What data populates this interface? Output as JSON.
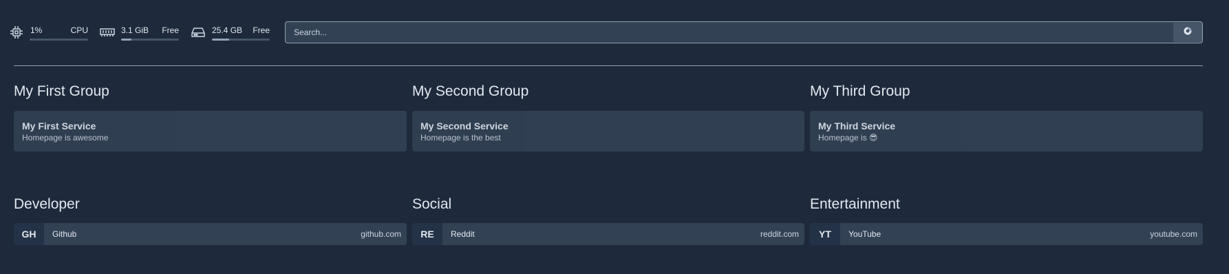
{
  "resources": {
    "cpu": {
      "value": "1%",
      "label": "CPU",
      "usage": 0.01
    },
    "memory": {
      "value": "3.1 GiB",
      "label": "Free",
      "usage": 0.18
    },
    "disk": {
      "value": "25.4 GB",
      "label": "Free",
      "usage": 0.3
    }
  },
  "search": {
    "placeholder": "Search..."
  },
  "services": [
    {
      "group": "My First Group",
      "name": "My First Service",
      "description": "Homepage is awesome"
    },
    {
      "group": "My Second Group",
      "name": "My Second Service",
      "description": "Homepage is the best"
    },
    {
      "group": "My Third Group",
      "name": "My Third Service",
      "description": "Homepage is 😎"
    }
  ],
  "bookmarks": [
    {
      "group": "Developer",
      "abbr": "GH",
      "name": "Github",
      "url": "github.com"
    },
    {
      "group": "Social",
      "abbr": "RE",
      "name": "Reddit",
      "url": "reddit.com"
    },
    {
      "group": "Entertainment",
      "abbr": "YT",
      "name": "YouTube",
      "url": "youtube.com"
    }
  ]
}
